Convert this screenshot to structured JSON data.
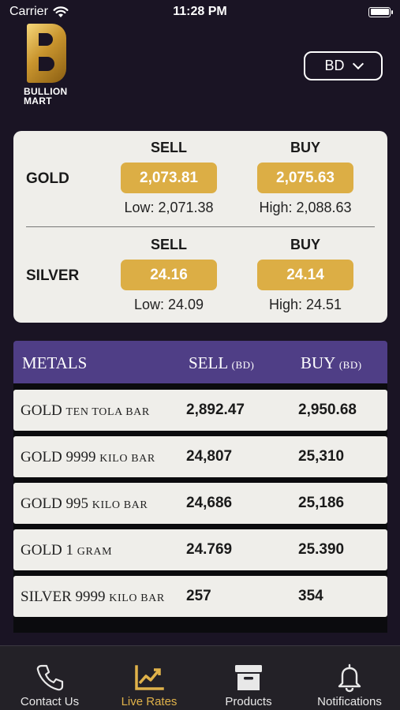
{
  "status_bar": {
    "carrier": "Carrier",
    "time": "11:28 PM"
  },
  "logo": {
    "line1": "BULLION",
    "line2": "MART"
  },
  "currency": {
    "selected": "BD"
  },
  "spot": {
    "sell_label": "SELL",
    "buy_label": "BUY",
    "gold": {
      "name": "GOLD",
      "sell": "2,073.81",
      "buy": "2,075.63",
      "low": "Low: 2,071.38",
      "high": "High: 2,088.63"
    },
    "silver": {
      "name": "SILVER",
      "sell": "24.16",
      "buy": "24.14",
      "low": "Low: 24.09",
      "high": "High: 24.51"
    }
  },
  "table": {
    "headers": {
      "metals": "METALS",
      "sell": "SELL",
      "buy": "BUY",
      "unit": "(BD)"
    },
    "rows": [
      {
        "name": "GOLD",
        "sub": "TEN TOLA BAR",
        "sell": "2,892.47",
        "buy": "2,950.68"
      },
      {
        "name": "GOLD 9999",
        "sub": "KILO BAR",
        "sell": "24,807",
        "buy": "25,310"
      },
      {
        "name": "GOLD 995",
        "sub": "KILO BAR",
        "sell": "24,686",
        "buy": "25,186"
      },
      {
        "name": "GOLD 1",
        "sub": "GRAM",
        "sell": "24.769",
        "buy": "25.390"
      },
      {
        "name": "SILVER 9999",
        "sub": "KILO BAR",
        "sell": "257",
        "buy": "354"
      }
    ]
  },
  "tabs": [
    {
      "label": "Contact Us",
      "icon": "phone-icon"
    },
    {
      "label": "Live Rates",
      "icon": "chart-icon",
      "active": true
    },
    {
      "label": "Products",
      "icon": "archive-box-icon"
    },
    {
      "label": "Notifications",
      "icon": "bell-icon"
    }
  ],
  "colors": {
    "background": "#1a1424",
    "gold_accent": "#dcae45",
    "table_header": "#4f3e86",
    "active_tab": "#e0b24a"
  }
}
